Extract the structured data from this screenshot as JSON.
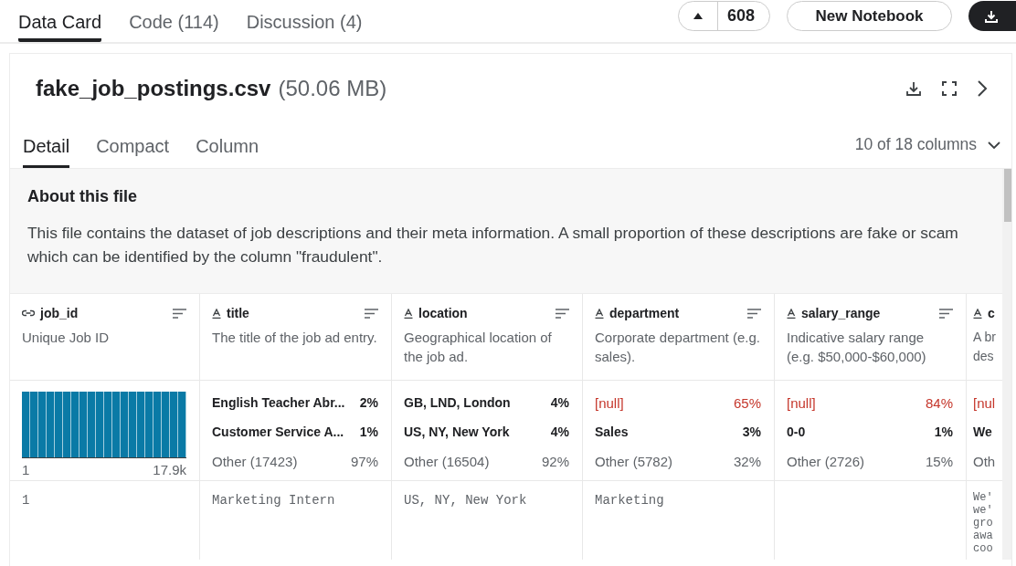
{
  "tabs": [
    {
      "label": "Data Card",
      "selected": true
    },
    {
      "label": "Code (114)",
      "selected": false
    },
    {
      "label": "Discussion (4)",
      "selected": false
    }
  ],
  "upvote": {
    "count": "608"
  },
  "new_notebook": {
    "label": "New Notebook"
  },
  "file": {
    "name": "fake_job_postings.csv",
    "size": "(50.06 MB)"
  },
  "view_tabs": [
    {
      "label": "Detail",
      "selected": true
    },
    {
      "label": "Compact",
      "selected": false
    },
    {
      "label": "Column",
      "selected": false
    }
  ],
  "columns_picker": {
    "label": "10 of 18 columns"
  },
  "about": {
    "title": "About this file",
    "text": "This file contains the dataset of job descriptions and their meta information. A small proportion of these descriptions are fake or scam which can be identified by the column \"fraudulent\"."
  },
  "table": {
    "columns": [
      {
        "name": "job_id",
        "kind": "id",
        "description": "Unique Job ID",
        "histogram": {
          "min": "1",
          "max": "17.9k"
        },
        "value": "1"
      },
      {
        "name": "title",
        "kind": "string",
        "description": "The title of the job ad entry.",
        "stats": [
          {
            "label": "English Teacher Abr...",
            "pct": "2%",
            "kind": "value"
          },
          {
            "label": "Customer Service A...",
            "pct": "1%",
            "kind": "value"
          },
          {
            "label": "Other (17423)",
            "pct": "97%",
            "kind": "other"
          }
        ],
        "value": "Marketing Intern"
      },
      {
        "name": "location",
        "kind": "string",
        "description": "Geographical location of the job ad.",
        "stats": [
          {
            "label": "GB, LND, London",
            "pct": "4%",
            "kind": "value"
          },
          {
            "label": "US, NY, New York",
            "pct": "4%",
            "kind": "value"
          },
          {
            "label": "Other (16504)",
            "pct": "92%",
            "kind": "other"
          }
        ],
        "value": "US, NY, New York"
      },
      {
        "name": "department",
        "kind": "string",
        "description": "Corporate department (e.g. sales).",
        "stats": [
          {
            "label": "[null]",
            "pct": "65%",
            "kind": "null"
          },
          {
            "label": "Sales",
            "pct": "3%",
            "kind": "value"
          },
          {
            "label": "Other (5782)",
            "pct": "32%",
            "kind": "other"
          }
        ],
        "value": "Marketing"
      },
      {
        "name": "salary_range",
        "kind": "string",
        "description": "Indicative salary range (e.g. $50,000-$60,000)",
        "stats": [
          {
            "label": "[null]",
            "pct": "84%",
            "kind": "null"
          },
          {
            "label": "0-0",
            "pct": "1%",
            "kind": "value"
          },
          {
            "label": "Other (2726)",
            "pct": "15%",
            "kind": "other"
          }
        ]
      },
      {
        "name": "c",
        "kind": "string",
        "description": "A br\ndes",
        "stats": [
          {
            "label": "[nul",
            "kind": "null"
          },
          {
            "label": "We",
            "kind": "value"
          },
          {
            "label": "Oth",
            "kind": "other"
          }
        ],
        "value": "We'\nwe'\ngro\nawa\ncoo"
      }
    ]
  }
}
